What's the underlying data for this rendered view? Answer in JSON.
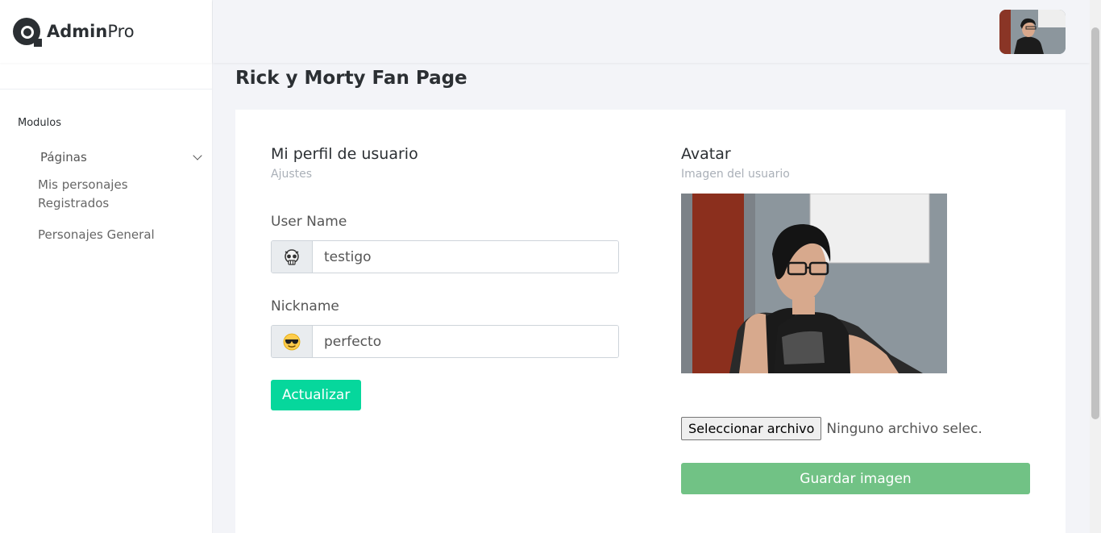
{
  "brand": {
    "bold": "Admin",
    "light": "Pro"
  },
  "sidebar": {
    "section_title": "Modulos",
    "group_label": "Páginas",
    "items": [
      {
        "label": "Mis personajes Registrados"
      },
      {
        "label": "Personajes General"
      }
    ]
  },
  "main": {
    "page_title": "Rick y Morty Fan Page"
  },
  "profile": {
    "title": "Mi perfil de usuario",
    "subtitle": "Ajustes",
    "username_label": "User Name",
    "username_value": "testigo",
    "nickname_label": "Nickname",
    "nickname_value": "perfecto",
    "update_button": "Actualizar"
  },
  "avatar": {
    "title": "Avatar",
    "subtitle": "Imagen del usuario",
    "file_button": "Seleccionar archivo",
    "file_status": "Ninguno archivo selec.",
    "save_button": "Guardar imagen"
  },
  "icons": {
    "username_addon": "skull-emoji",
    "nickname_addon": "sunglasses-emoji"
  },
  "colors": {
    "update_button": "#06d79c",
    "save_button": "#71c285"
  }
}
